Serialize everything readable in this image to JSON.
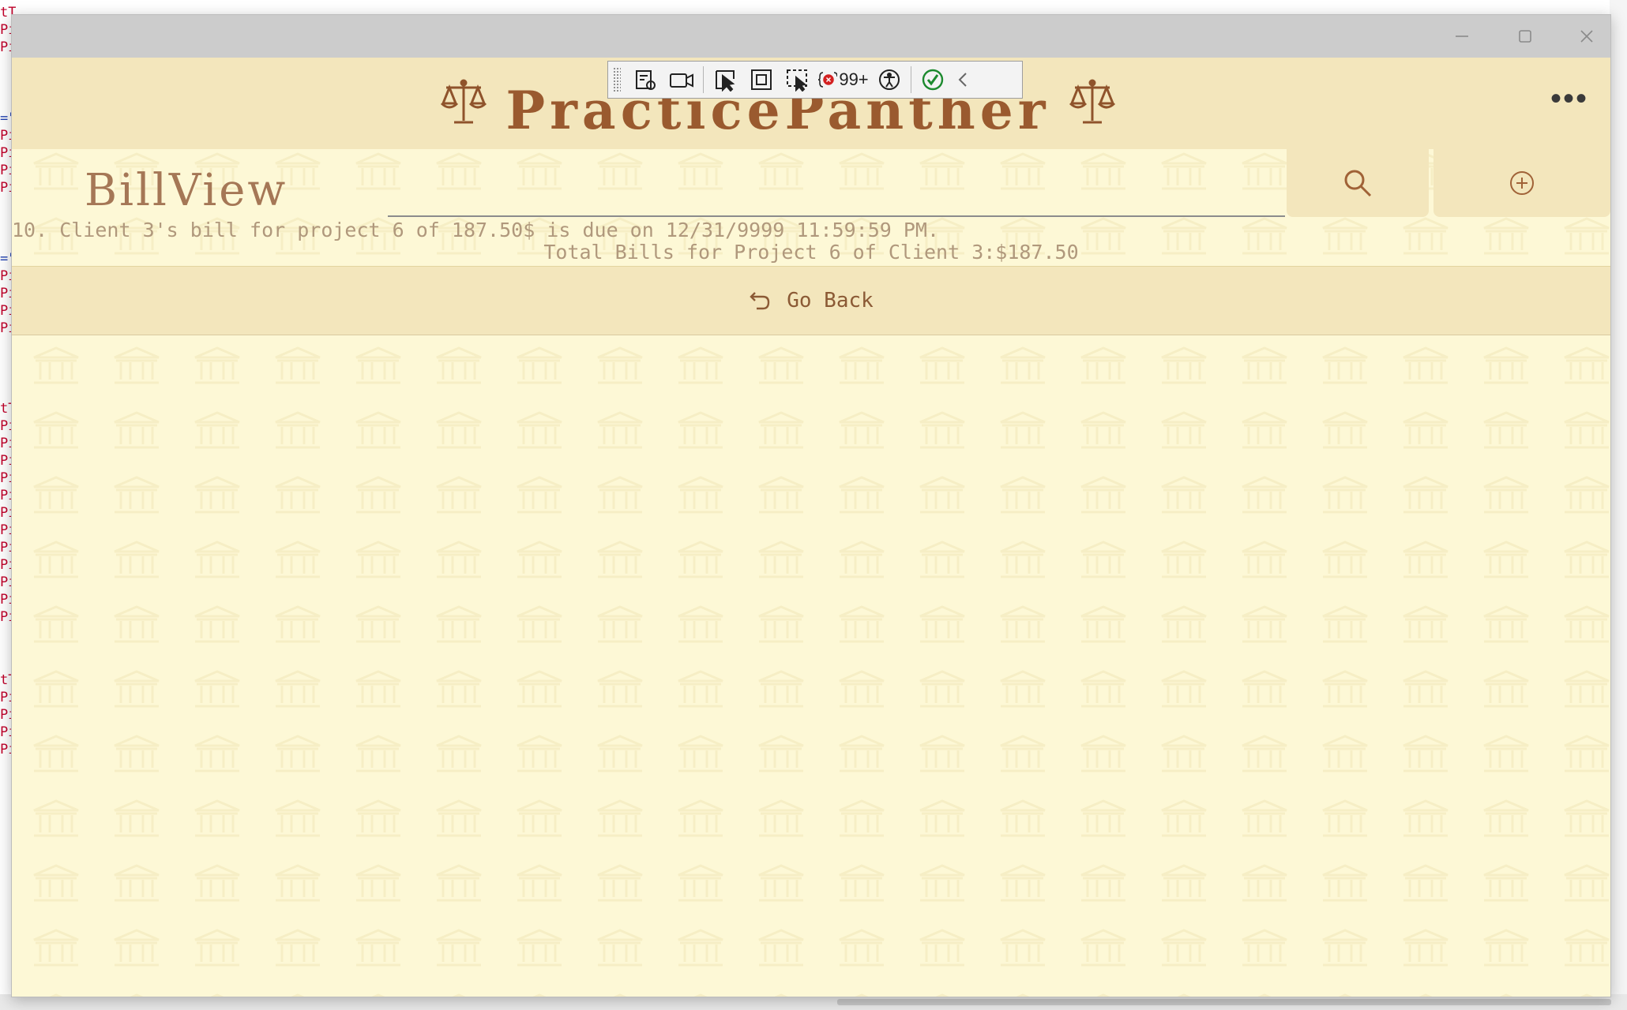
{
  "app": {
    "brand_title": "PracticePanther",
    "page_title": "BillView"
  },
  "window_controls": {
    "minimize_icon": "minimize-icon",
    "maximize_icon": "maximize-icon",
    "close_icon": "close-icon"
  },
  "debug_toolbar": {
    "error_count": "99+"
  },
  "search": {
    "value": "",
    "placeholder": ""
  },
  "bills": {
    "line": "10. Client 3's bill for project 6 of 187.50$ is due on 12/31/9999 11:59:59 PM.",
    "total": "Total Bills for Project 6 of Client 3:$187.50"
  },
  "actions": {
    "go_back_label": "Go Back"
  },
  "colors": {
    "header_bg": "#f3e6bc",
    "content_bg": "#fdf8d6",
    "brand_brown": "#9a5a2f"
  }
}
